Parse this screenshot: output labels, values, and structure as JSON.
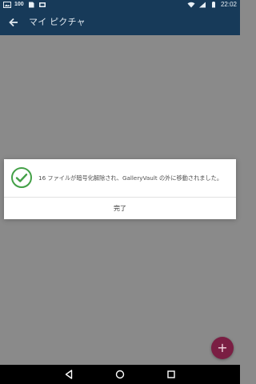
{
  "status_bar": {
    "battery_text": "100",
    "time": "22:02",
    "icons": [
      "image-icon",
      "battery-icon",
      "sd-card-icon",
      "gallery-icon",
      "wifi-icon",
      "signal-icon",
      "battery-full-icon"
    ]
  },
  "app_bar": {
    "back_icon": "back-arrow-icon",
    "title": "マイ ピクチャ"
  },
  "dialog": {
    "icon": "check-circle-icon",
    "message": "16 ファイルが暗号化解除され、GalleryVault の外に移動されました。",
    "action_label": "完了"
  },
  "fab": {
    "icon": "plus-icon",
    "label": "+"
  },
  "nav_bar": {
    "back_icon": "nav-back-icon",
    "home_icon": "nav-home-icon",
    "recents_icon": "nav-recents-icon"
  },
  "colors": {
    "app_bar": "#173a59",
    "overlay": "#8a8a8a",
    "check_green": "#43a047",
    "fab": "#7a1e43",
    "nav_bar": "#000000"
  }
}
